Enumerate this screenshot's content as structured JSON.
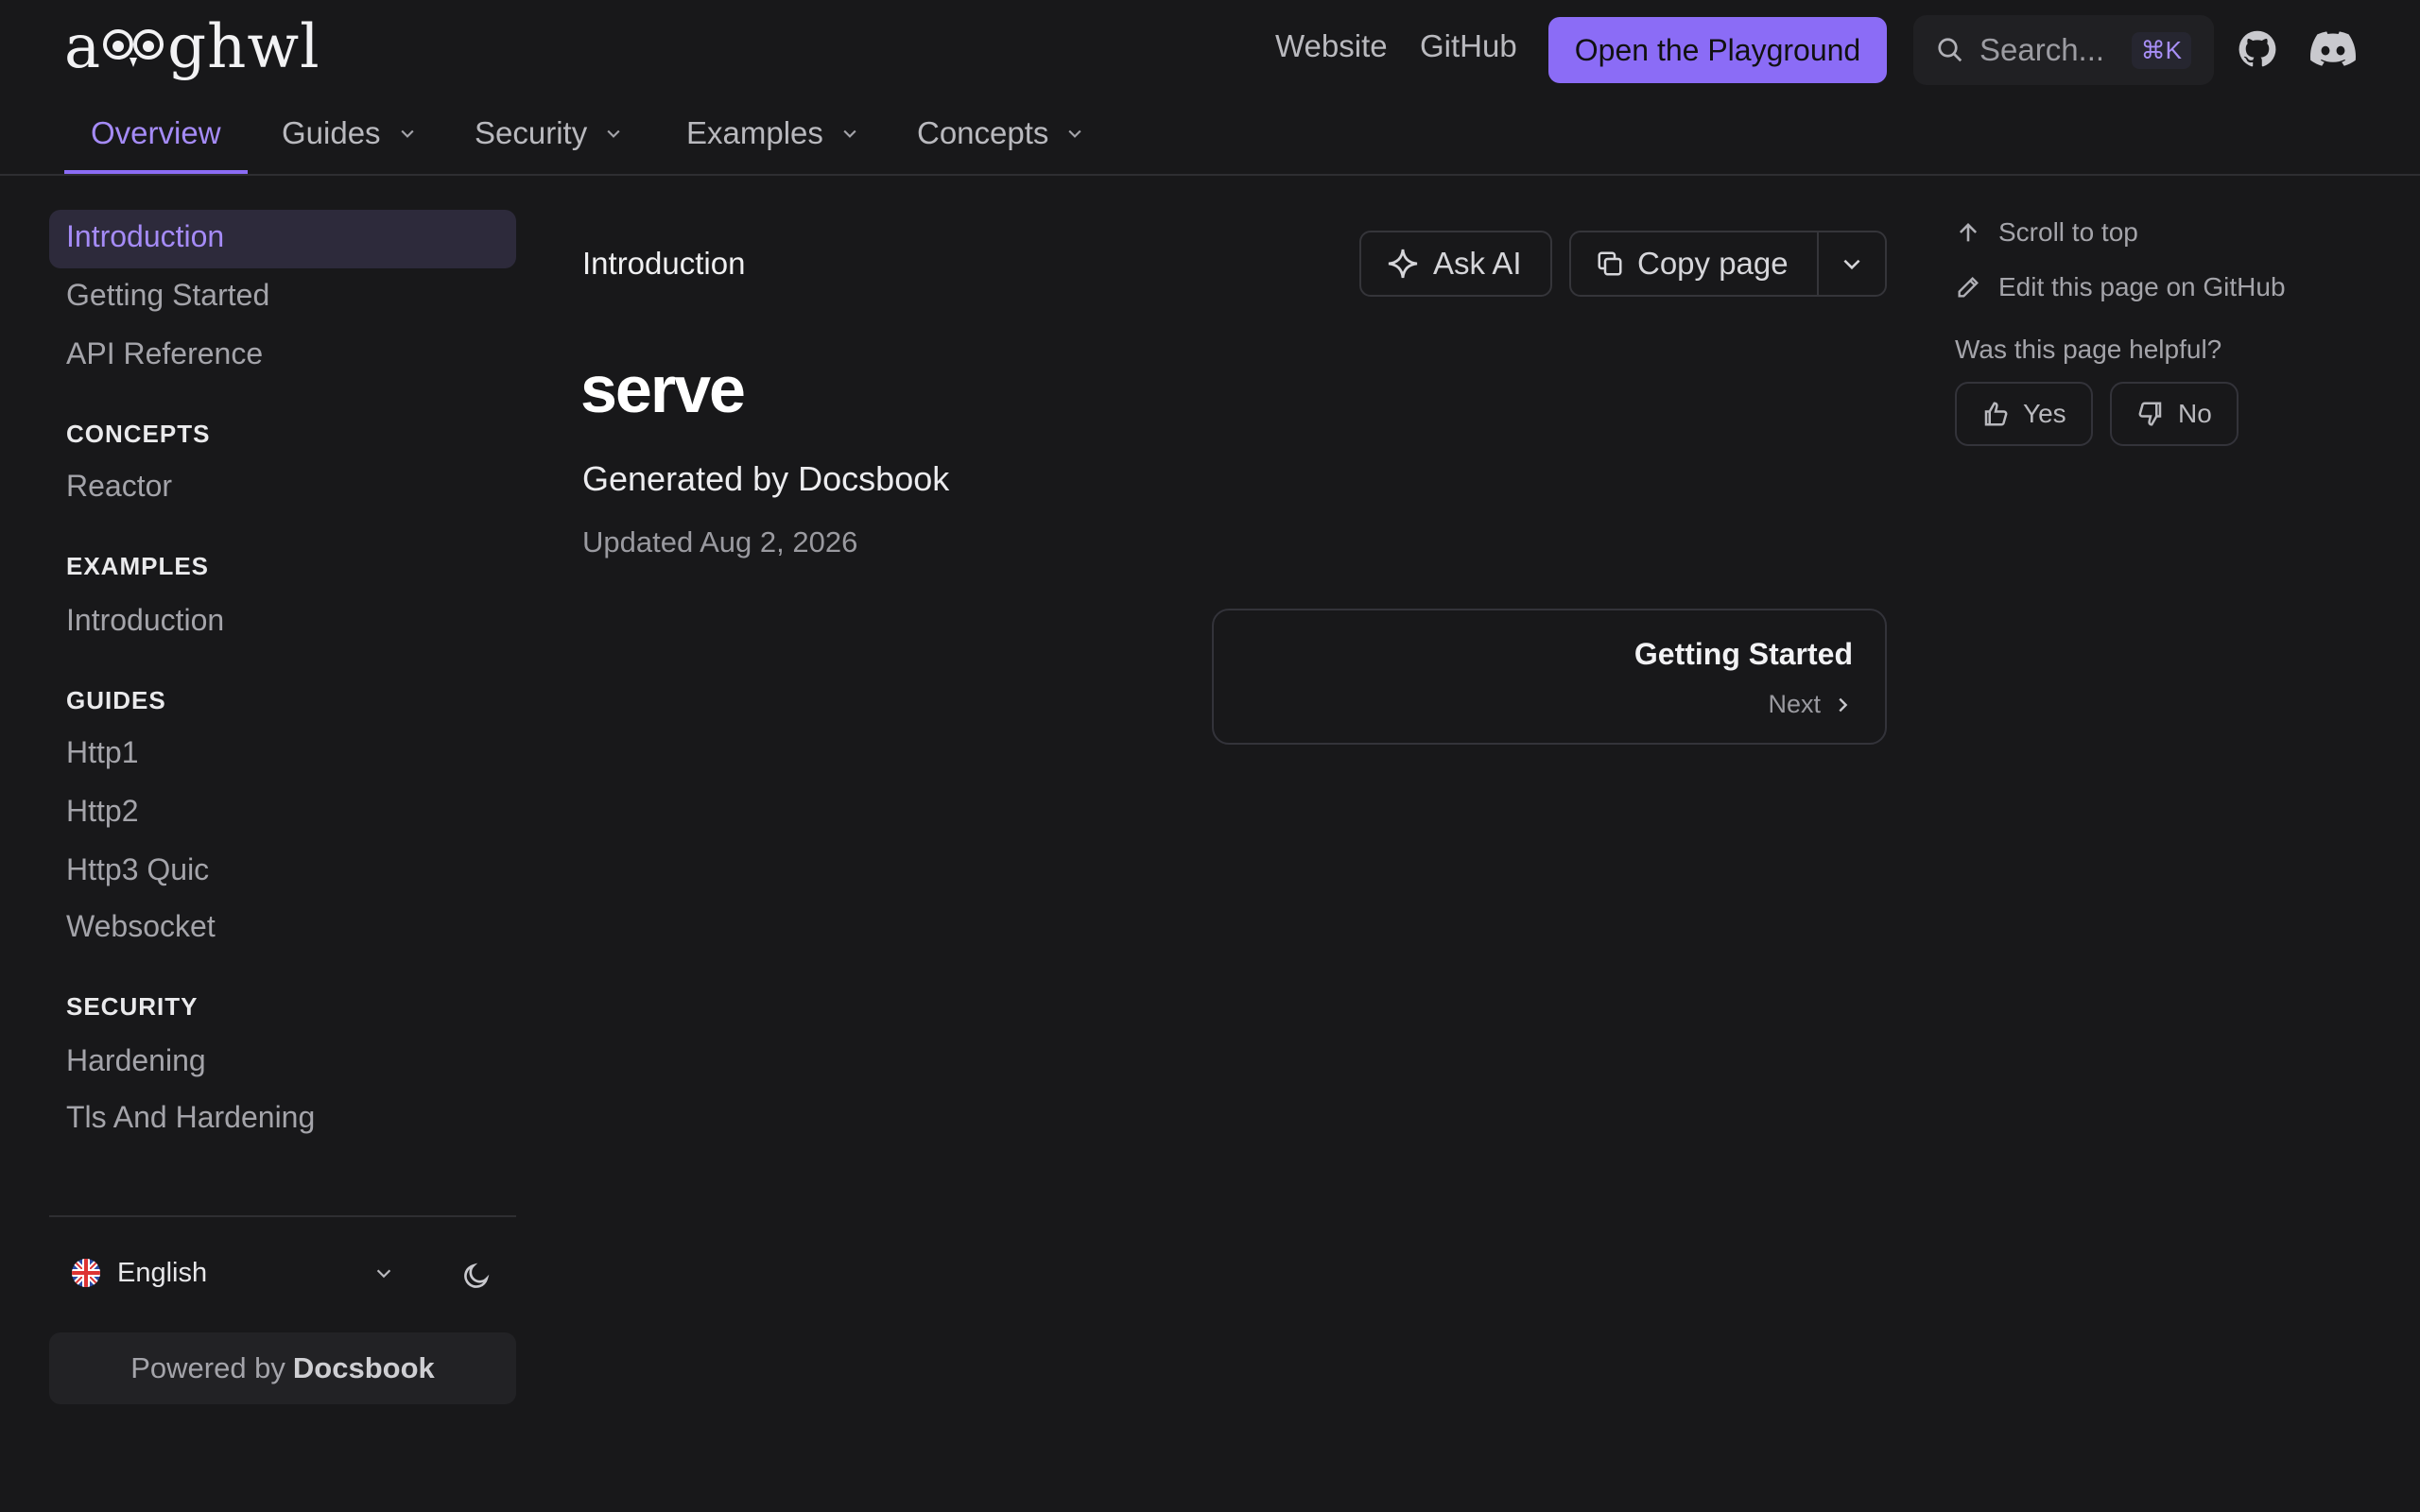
{
  "header": {
    "logo_text": "a ghwl",
    "nav_links": [
      "Website",
      "GitHub"
    ],
    "cta_label": "Open the Playground",
    "search_placeholder": "Search...",
    "search_shortcut": "⌘K",
    "icons": [
      "github-icon",
      "discord-icon"
    ]
  },
  "tabs": [
    {
      "label": "Overview",
      "active": true
    },
    {
      "label": "Guides"
    },
    {
      "label": "Security"
    },
    {
      "label": "Examples"
    },
    {
      "label": "Concepts"
    }
  ],
  "sidebar": {
    "items": [
      "Introduction",
      "Getting Started",
      "API Reference"
    ],
    "groups": [
      {
        "heading": "CONCEPTS",
        "items": [
          "Reactor"
        ]
      },
      {
        "heading": "EXAMPLES",
        "items": [
          "Introduction"
        ]
      },
      {
        "heading": "GUIDES",
        "items": [
          "Http1",
          "Http2",
          "Http3 Quic",
          "Websocket"
        ]
      },
      {
        "heading": "SECURITY",
        "items": [
          "Hardening",
          "Tls And Hardening"
        ]
      }
    ],
    "language": "English",
    "powered_prefix": "Powered by",
    "powered_brand": "Docsbook"
  },
  "main": {
    "breadcrumb": "Introduction",
    "ask_ai": "Ask AI",
    "copy_page": "Copy page",
    "title": "serve",
    "subtitle": "Generated by Docsbook",
    "updated": "Updated Aug 2, 2026",
    "next_title": "Getting Started",
    "next_label": "Next"
  },
  "rail": {
    "scroll_top": "Scroll to top",
    "edit_github": "Edit this page on GitHub",
    "helpful_q": "Was this page helpful?",
    "yes": "Yes",
    "no": "No"
  },
  "colors": {
    "accent": "#8b6cf6",
    "background": "#18181a"
  }
}
